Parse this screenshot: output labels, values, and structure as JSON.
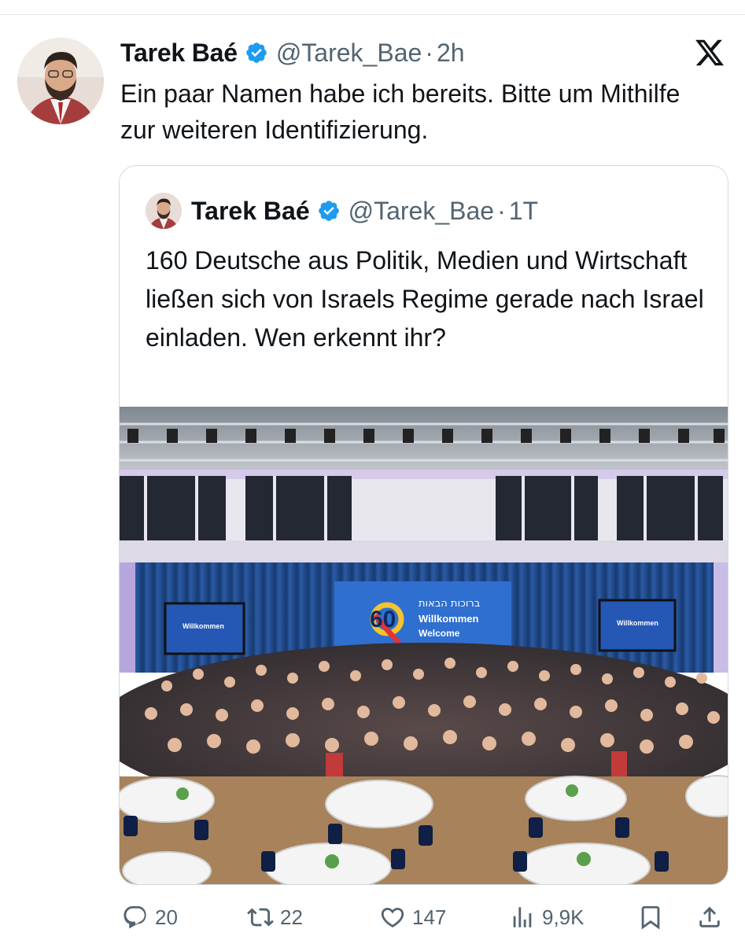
{
  "tweet": {
    "author_name": "Tarek Baé",
    "handle": "@Tarek_Bae",
    "separator": "·",
    "time": "2h",
    "text": "Ein paar Namen habe ich bereits. Bitte um Mithilfe zur weiteren Identifizierung."
  },
  "quoted_tweet": {
    "author_name": "Tarek Baé",
    "handle": "@Tarek_Bae",
    "separator": "·",
    "time": "1T",
    "text": "160 Deutsche aus Politik, Medien und Wirtschaft ließen sich von Israels Regime gerade nach Israel einladen. Wen erkennt ihr?",
    "image": {
      "banner_hebrew": "ברוכות הבאות",
      "banner_line1": "Willkommen",
      "banner_line2": "Welcome",
      "banner_number": "60"
    }
  },
  "actions": {
    "replies": "20",
    "reposts": "22",
    "likes": "147",
    "views": "9,9K"
  },
  "colors": {
    "verified_blue": "#1d9bf0",
    "text_primary": "#0f1419",
    "text_secondary": "#536471",
    "border": "#cfd9de"
  },
  "icons": [
    "verified-badge-icon",
    "x-logo-icon",
    "reply-icon",
    "repost-icon",
    "like-icon",
    "views-icon",
    "bookmark-icon",
    "share-icon"
  ]
}
